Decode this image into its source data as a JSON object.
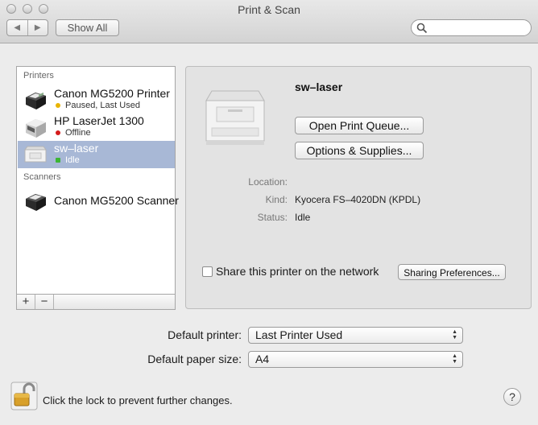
{
  "window": {
    "title": "Print & Scan"
  },
  "toolbar": {
    "back_glyph": "◀",
    "forward_glyph": "▶",
    "show_all_label": "Show All",
    "search_placeholder": ""
  },
  "list": {
    "printers_header": "Printers",
    "scanners_header": "Scanners",
    "printers": [
      {
        "name": "Canon MG5200 Printer",
        "status": "Paused, Last Used",
        "status_color": "#e8b400",
        "icon": "inkjet-printer-icon"
      },
      {
        "name": "HP LaserJet 1300",
        "status": "Offline",
        "status_color": "#d51c1c",
        "icon": "laser-printer-icon"
      },
      {
        "name": "sw–laser",
        "status": "Idle",
        "status_color": "#3cb534",
        "icon": "office-printer-icon",
        "selected": true
      }
    ],
    "scanners": [
      {
        "name": "Canon MG5200 Scanner",
        "icon": "inkjet-scanner-icon"
      }
    ],
    "add_label": "+",
    "remove_label": "−"
  },
  "detail": {
    "printer_name": "sw–laser",
    "open_queue_label": "Open Print Queue...",
    "options_label": "Options & Supplies...",
    "location_label": "Location:",
    "location_value": "",
    "kind_label": "Kind:",
    "kind_value": "Kyocera FS–4020DN (KPDL)",
    "status_label": "Status:",
    "status_value": "Idle",
    "share_label": "Share this printer on the network",
    "share_checked": false,
    "sharing_prefs_label": "Sharing Preferences..."
  },
  "defaults": {
    "printer_label": "Default printer:",
    "printer_value": "Last Printer Used",
    "paper_label": "Default paper size:",
    "paper_value": "A4"
  },
  "footer": {
    "lock_text": "Click the lock to prevent further changes.",
    "help_label": "?"
  },
  "colors": {
    "selection": "#a8b8d6",
    "panel": "#e3e3e3",
    "window": "#ececec"
  }
}
